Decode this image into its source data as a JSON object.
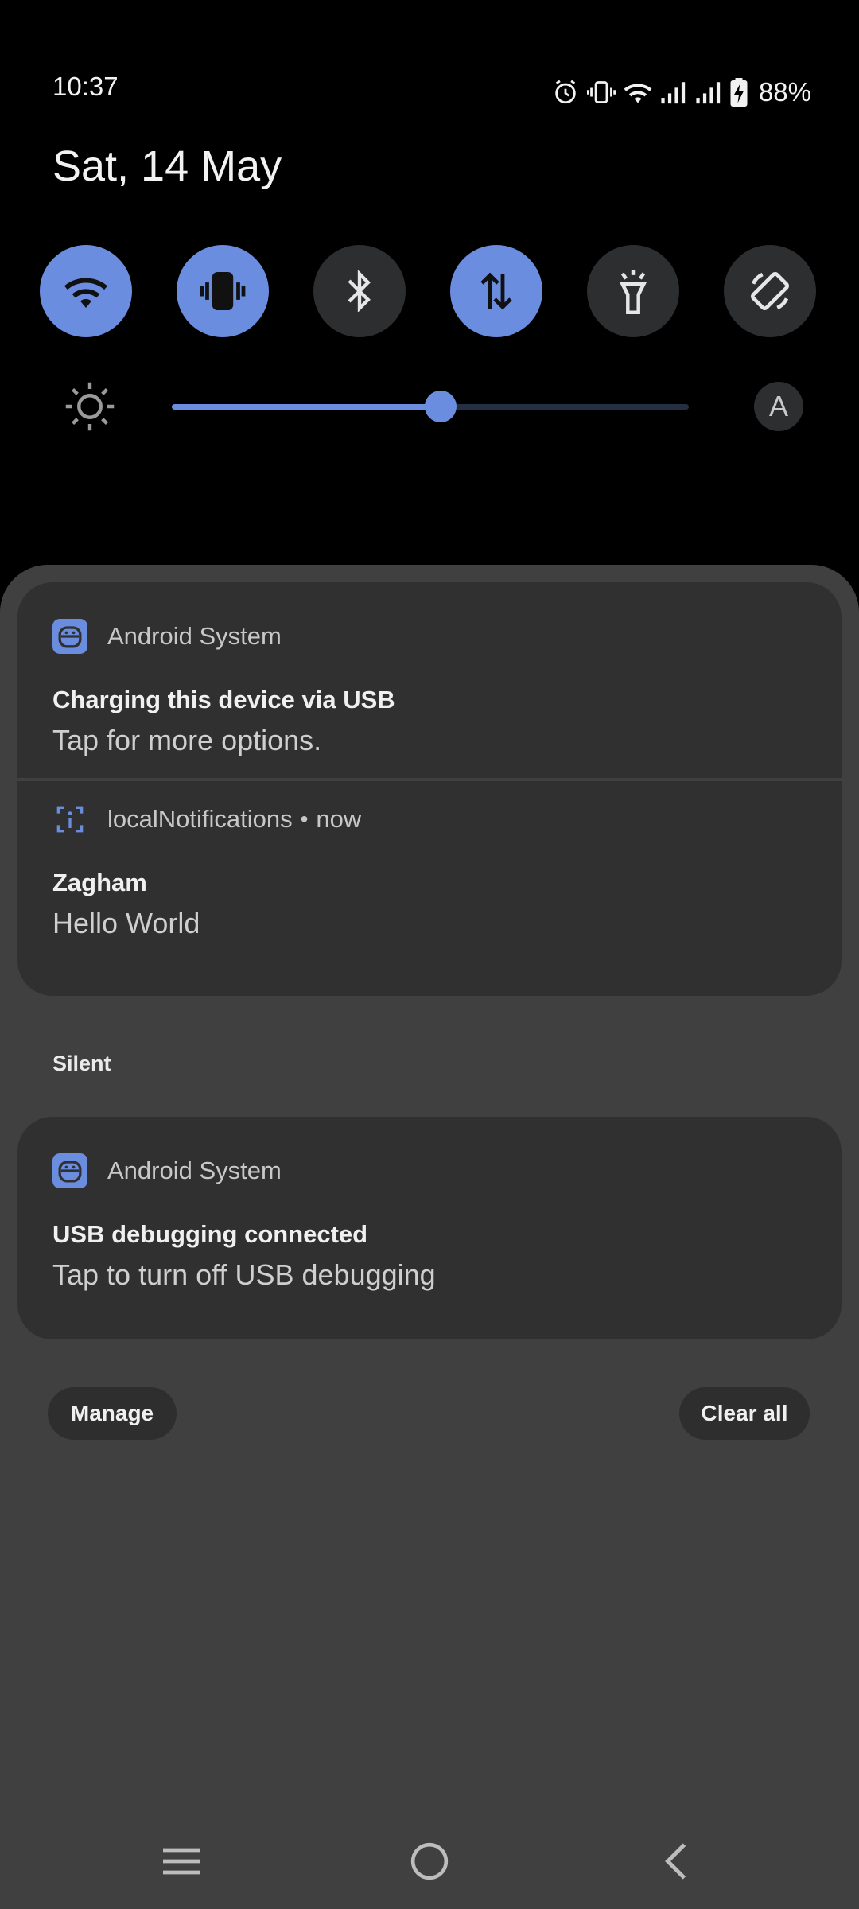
{
  "status_bar": {
    "time": "10:37",
    "battery": "88%",
    "icons": [
      "alarm-icon",
      "vibrate-icon",
      "wifi-icon",
      "signal-icon",
      "signal-icon",
      "battery-charging-icon"
    ]
  },
  "header": {
    "date": "Sat, 14 May"
  },
  "quick_settings": {
    "tiles": [
      {
        "icon": "wifi-icon",
        "active": true
      },
      {
        "icon": "vibrate-icon",
        "active": true
      },
      {
        "icon": "bluetooth-icon",
        "active": false
      },
      {
        "icon": "mobile-data-icon",
        "active": true
      },
      {
        "icon": "flashlight-icon",
        "active": false
      },
      {
        "icon": "auto-rotate-icon",
        "active": false
      }
    ],
    "brightness": {
      "level": 0.52,
      "auto_label": "A"
    }
  },
  "notifications": [
    {
      "app": "Android System",
      "title": "Charging this device via USB",
      "text": "Tap for more options."
    },
    {
      "app": "localNotifications",
      "separator": "•",
      "time": "now",
      "title": "Zagham",
      "text": "Hello World"
    }
  ],
  "silent_section": {
    "label": "Silent",
    "notification": {
      "app": "Android System",
      "title": "USB debugging connected",
      "text": "Tap to turn off USB debugging"
    }
  },
  "actions": {
    "manage": "Manage",
    "clear_all": "Clear all"
  },
  "colors": {
    "accent": "#6b8de0",
    "tile_off": "#2c2e30",
    "panel": "#404040",
    "card": "#303030"
  },
  "nav_bar": {
    "icons": [
      "recents-icon",
      "home-icon",
      "back-icon"
    ]
  }
}
